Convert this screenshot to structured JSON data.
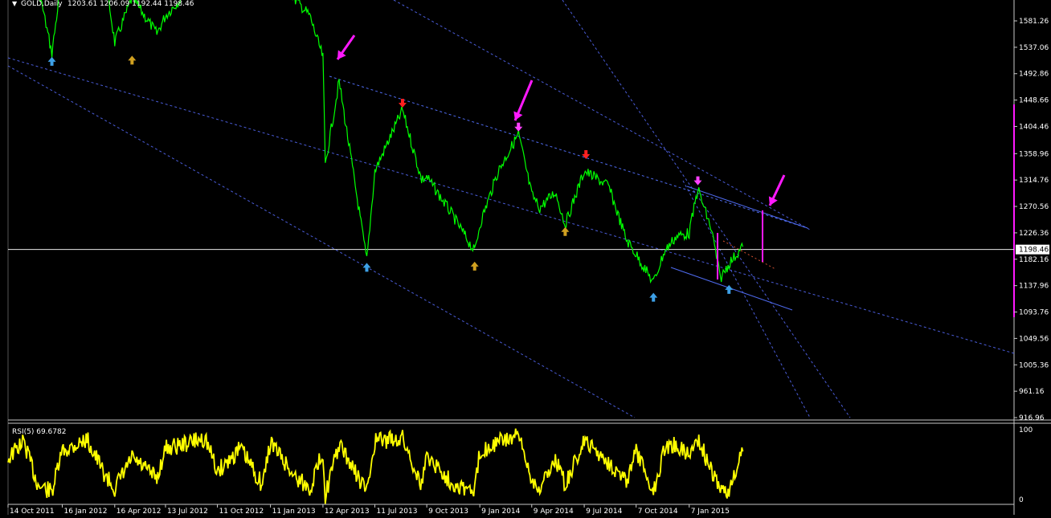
{
  "colors": {
    "background": "#000000",
    "frame": "#c8c8c8",
    "price_line": "#00ff00",
    "rsi_line": "#ffff00",
    "channel_line": "#4a5cd8",
    "wedge_line": "#4f6bf0",
    "current_price_line": "#e8e8e8",
    "arrow_annotation": "#ff19ff",
    "arrow_up_blue": "#3da0e6",
    "arrow_up_gold": "#d0a020",
    "arrow_down_red": "#ff2020",
    "arrow_down_magenta": "#ff40ff",
    "projection_dash": "#d05030"
  },
  "header": {
    "title": "GOLD,Daily",
    "ohlc": "1203.61 1206.09 1192.44 1198.46"
  },
  "rsi_panel": {
    "label": "RSI(5) 69.6782",
    "scale_top": "100",
    "scale_bottom": "0"
  },
  "chart_data": [
    {
      "type": "line",
      "name": "GOLD,Daily",
      "x": [
        "2011-10-14",
        "2011-11-10",
        "2011-12-05",
        "2011-12-29",
        "2012-01-16",
        "2012-02-28",
        "2012-03-30",
        "2012-04-16",
        "2012-05-16",
        "2012-06-28",
        "2012-07-13",
        "2012-08-10",
        "2012-09-20",
        "2012-10-11",
        "2012-11-20",
        "2012-12-28",
        "2013-01-11",
        "2013-02-20",
        "2013-03-20",
        "2013-04-12",
        "2013-04-16",
        "2013-05-10",
        "2013-06-27",
        "2013-07-11",
        "2013-08-28",
        "2013-09-30",
        "2013-10-09",
        "2013-11-20",
        "2013-12-31",
        "2014-01-09",
        "2014-02-10",
        "2014-03-17",
        "2014-04-09",
        "2014-04-23",
        "2014-05-20",
        "2014-06-06",
        "2014-07-09",
        "2014-08-20",
        "2014-09-20",
        "2014-10-07",
        "2014-11-06",
        "2014-11-25",
        "2014-12-15",
        "2015-01-07",
        "2015-01-22",
        "2015-02-15",
        "2015-03-02",
        "2015-03-17",
        "2015-04-10"
      ],
      "values": [
        1660,
        1780,
        1640,
        1527,
        1660,
        1780,
        1660,
        1545,
        1620,
        1560,
        1590,
        1620,
        1780,
        1740,
        1710,
        1640,
        1690,
        1620,
        1590,
        1520,
        1340,
        1480,
        1180,
        1330,
        1432,
        1315,
        1320,
        1260,
        1195,
        1240,
        1330,
        1392,
        1290,
        1268,
        1295,
        1240,
        1330,
        1305,
        1215,
        1190,
        1143,
        1195,
        1220,
        1226,
        1300,
        1230,
        1150,
        1175,
        1203
      ],
      "ylim": [
        916.96,
        1600
      ],
      "yticks": [
        "1581.26",
        "1537.06",
        "1492.86",
        "1448.66",
        "1404.46",
        "1358.96",
        "1314.76",
        "1270.56",
        "1226.36",
        "1182.16",
        "1137.96",
        "1093.76",
        "1049.56",
        "1005.36",
        "961.16",
        "916.96"
      ],
      "current_price": "1198.46",
      "xtick_labels": [
        "14 Oct 2011",
        "16 Jan 2012",
        "16 Apr 2012",
        "13 Jul 2012",
        "11 Oct 2012",
        "11 Jan 2013",
        "12 Apr 2013",
        "11 Jul 2013",
        "9 Oct 2013",
        "9 Jan 2014",
        "9 Apr 2014",
        "9 Jul 2014",
        "7 Oct 2014",
        "7 Jan 2015"
      ],
      "markers": [
        {
          "date": "2011-12-29",
          "value": 1525,
          "kind": "arrow_up_blue"
        },
        {
          "date": "2012-05-16",
          "value": 1527,
          "kind": "arrow_up_gold"
        },
        {
          "date": "2013-06-27",
          "value": 1180,
          "kind": "arrow_up_blue"
        },
        {
          "date": "2013-08-28",
          "value": 1432,
          "kind": "arrow_down_red"
        },
        {
          "date": "2013-12-31",
          "value": 1182,
          "kind": "arrow_up_gold"
        },
        {
          "date": "2014-03-17",
          "value": 1392,
          "kind": "arrow_down_magenta"
        },
        {
          "date": "2014-06-06",
          "value": 1240,
          "kind": "arrow_up_gold"
        },
        {
          "date": "2014-07-12",
          "value": 1346,
          "kind": "arrow_down_red"
        },
        {
          "date": "2014-11-06",
          "value": 1130,
          "kind": "arrow_up_blue"
        },
        {
          "date": "2015-01-22",
          "value": 1302,
          "kind": "arrow_down_magenta"
        },
        {
          "date": "2015-03-17",
          "value": 1143,
          "kind": "arrow_up_blue"
        }
      ],
      "grid": false
    },
    {
      "type": "line",
      "name": "RSI(5)",
      "last_value": 69.6782,
      "ylim": [
        0,
        100
      ],
      "x": [
        "2011-10-14",
        "2011-11-10",
        "2011-12-05",
        "2011-12-29",
        "2012-01-16",
        "2012-02-28",
        "2012-03-30",
        "2012-04-16",
        "2012-05-16",
        "2012-06-28",
        "2012-07-13",
        "2012-08-10",
        "2012-09-20",
        "2012-10-11",
        "2012-11-20",
        "2012-12-28",
        "2013-01-11",
        "2013-02-20",
        "2013-03-20",
        "2013-04-12",
        "2013-04-16",
        "2013-05-10",
        "2013-06-27",
        "2013-07-11",
        "2013-08-28",
        "2013-09-30",
        "2013-10-09",
        "2013-11-20",
        "2013-12-31",
        "2014-01-09",
        "2014-02-10",
        "2014-03-17",
        "2014-04-09",
        "2014-04-23",
        "2014-05-20",
        "2014-06-06",
        "2014-07-09",
        "2014-08-20",
        "2014-09-20",
        "2014-10-07",
        "2014-11-06",
        "2014-11-25",
        "2014-12-15",
        "2015-01-07",
        "2015-01-22",
        "2015-02-15",
        "2015-03-02",
        "2015-03-17",
        "2015-04-10"
      ],
      "values": [
        60,
        85,
        20,
        10,
        70,
        88,
        35,
        15,
        60,
        30,
        75,
        80,
        90,
        40,
        75,
        20,
        85,
        35,
        15,
        70,
        5,
        80,
        10,
        85,
        90,
        20,
        65,
        25,
        10,
        70,
        85,
        92,
        30,
        15,
        60,
        20,
        85,
        55,
        25,
        70,
        10,
        75,
        80,
        65,
        90,
        40,
        15,
        10,
        70
      ]
    }
  ]
}
